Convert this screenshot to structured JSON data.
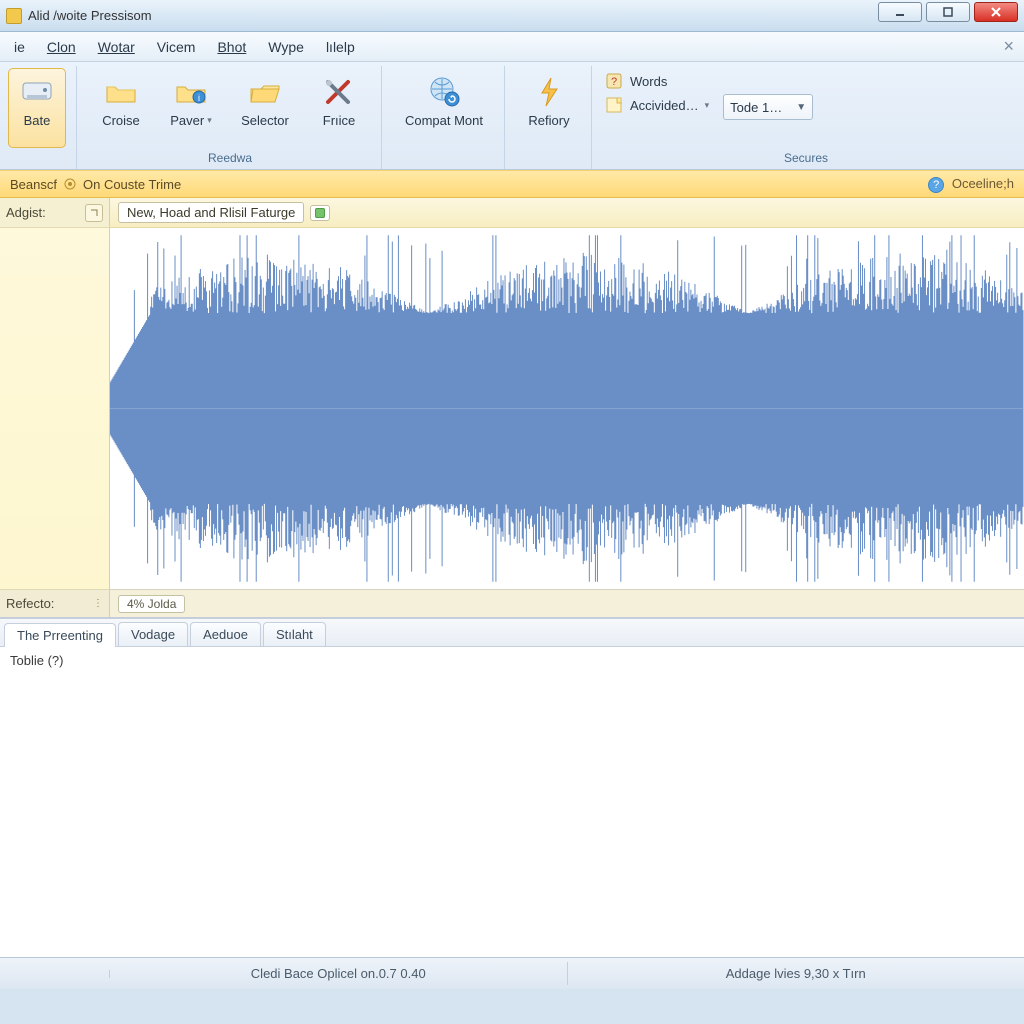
{
  "window": {
    "title": "Alid /woite Pressisom"
  },
  "menu": {
    "items": [
      "ie",
      "Clon",
      "Wotar",
      "Vicem",
      "Bhot",
      "Wype",
      "lılelp"
    ]
  },
  "ribbon": {
    "bate": "Bate",
    "croise": "Croise",
    "paver": "Paver",
    "selector": "Selector",
    "frice": "Frıice",
    "compat": "Compat Mont",
    "refiory": "Refiory",
    "words": "Words",
    "accivided": "Accivided…",
    "tode": "Tode 1…",
    "group_reedwa": "Reedwa",
    "group_secures": "Secures"
  },
  "infobar": {
    "left1": "Beanscf",
    "left2": "On Couste Trime",
    "right": "Oceeline;h"
  },
  "side": {
    "top": "Adgist:",
    "foot": "Refecto:"
  },
  "track": {
    "name": "New, Hoad and Rlisil Faturge",
    "foot1": "4% Jolda"
  },
  "tabs": {
    "t1": "The Prreenting",
    "t2": "Vodage",
    "t3": "Aeduoe",
    "t4": "Stılaht",
    "line1": "Toblie (?)"
  },
  "status": {
    "left": "",
    "mid": "Cledi Bace Oplicel on.0.7 0.40",
    "right": "Addage lvies 9,30 x Tırn"
  }
}
